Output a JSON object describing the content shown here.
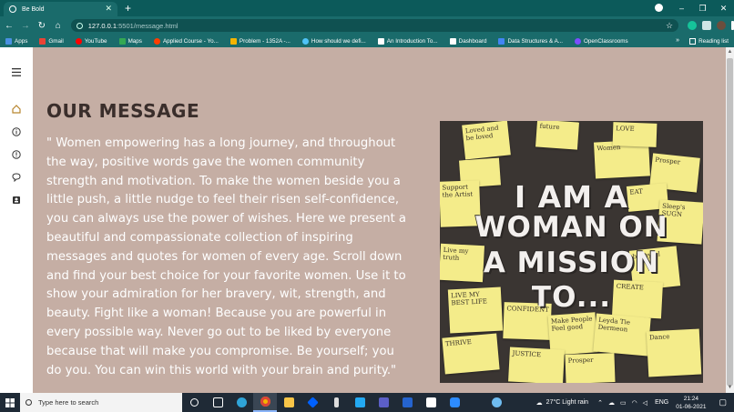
{
  "browser": {
    "tab_title": "Be Bold",
    "new_tab": "+",
    "url_host": "127.0.0.1",
    "url_path": ":5501/message.html",
    "window_controls": [
      "–",
      "❐",
      "✕"
    ]
  },
  "bookmarks": {
    "items": [
      {
        "label": "Apps",
        "color": "#4a90e2"
      },
      {
        "label": "Gmail",
        "color": "#ea4335"
      },
      {
        "label": "YouTube",
        "color": "#ff0000"
      },
      {
        "label": "Maps",
        "color": "#34a853"
      },
      {
        "label": "Applied Course - Yo...",
        "color": "#ff3d00"
      },
      {
        "label": "Problem - 1352A -...",
        "color": "#f4b400"
      },
      {
        "label": "How should we defi...",
        "color": "#4fc3f7"
      },
      {
        "label": "An Introduction To...",
        "color": "#ffffff"
      },
      {
        "label": "Dashboard",
        "color": "#ffffff"
      },
      {
        "label": "Data Structures & A...",
        "color": "#4285f4"
      },
      {
        "label": "OpenClassrooms",
        "color": "#7c4dff"
      }
    ],
    "more": "»",
    "reading_list": "Reading list"
  },
  "page": {
    "heading": "OUR MESSAGE",
    "message": "\" Women empowering has a long journey, and throughout the way, positive words gave the women community strength and motivation. To make the women beside you a little push, a little nudge to feel their risen self-confidence, you can always use the power of wishes. Here we present a beautiful and compassionate collection of inspiring messages and quotes for women of every age. Scroll down and find your best choice for your favorite women. Use it to show your admiration for her bravery, wit, strength, and beauty. Fight like a woman! Because you are powerful in every possible way. Never go out to be liked by everyone because that will make you compromise. Be yourself; you do you. You can win this world with your brain and purity.\"",
    "poster_lines": [
      "I AM A",
      "WOMAN ON",
      "A MISSION",
      "TO..."
    ],
    "poster_notes": [
      "Loved and be loved",
      "future",
      "Support the Artist",
      "Live my truth",
      "LIVE MY BEST LIFE",
      "Women",
      "Make People Feel good",
      "Leyda Tie Dermeon",
      "THRIVE",
      "JUSTICE",
      "Sleep's SUGN",
      "CREATE",
      "be joyful",
      "CONFIDENT",
      "LOVE",
      "EAT",
      "Prosper",
      "Dance"
    ],
    "poster_label": "sticky-notes-poster"
  },
  "taskbar": {
    "search_placeholder": "Type here to search",
    "weather": "27°C  Light rain",
    "language": "ENG",
    "time": "21:24",
    "date": "01-06-2021"
  }
}
